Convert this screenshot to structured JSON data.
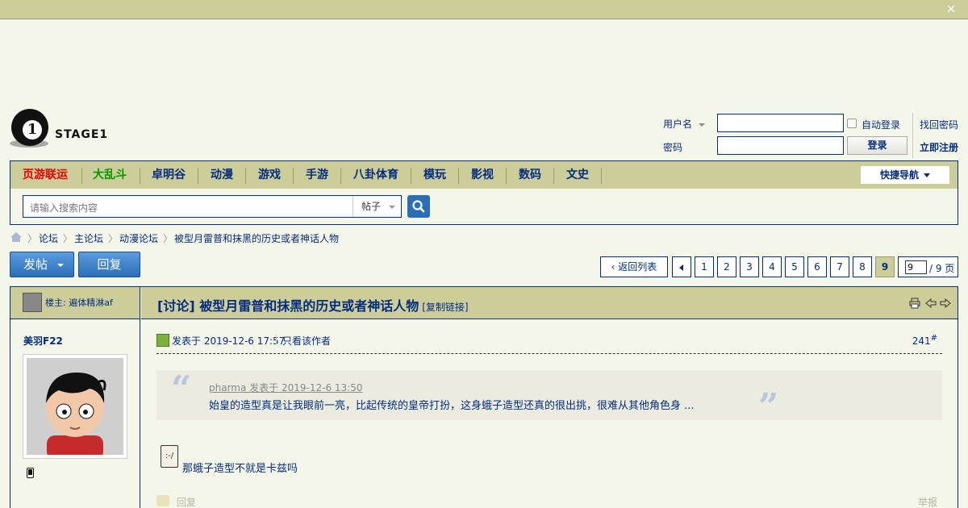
{
  "topbar": {
    "close_icon": "close-icon"
  },
  "logo": {
    "text": "STAGE1",
    "mark": "1"
  },
  "login": {
    "username_label": "用户名",
    "password_label": "密码",
    "auto_login_label": "自动登录",
    "login_button": "登录",
    "find_password": "找回密码",
    "register": "立即注册"
  },
  "nav": {
    "items": [
      {
        "label": "页游联运",
        "color": "#e60000"
      },
      {
        "label": "大乱斗",
        "color": "#009900"
      },
      {
        "label": "卓明谷",
        "color": "#022c80"
      },
      {
        "label": "动漫",
        "color": "#022c80"
      },
      {
        "label": "游戏",
        "color": "#022c80"
      },
      {
        "label": "手游",
        "color": "#022c80"
      },
      {
        "label": "八卦体育",
        "color": "#022c80"
      },
      {
        "label": "模玩",
        "color": "#022c80"
      },
      {
        "label": "影视",
        "color": "#022c80"
      },
      {
        "label": "数码",
        "color": "#022c80"
      },
      {
        "label": "文史",
        "color": "#022c80"
      }
    ],
    "quick_nav": "快捷导航"
  },
  "search": {
    "placeholder": "请输入搜索内容",
    "type": "帖子"
  },
  "breadcrumb": [
    "论坛",
    "主论坛",
    "动漫论坛",
    "被型月雷普和抹黑的历史或者神话人物"
  ],
  "actions": {
    "post": "发帖",
    "reply": "回复"
  },
  "pagination": {
    "back": "返回列表",
    "pages": [
      "1",
      "2",
      "3",
      "4",
      "5",
      "6",
      "7",
      "8",
      "9"
    ],
    "current": "9",
    "input_value": "9",
    "total": "/ 9 页"
  },
  "post": {
    "owner_label": "楼主: 遍体精淋af",
    "author": "美羽F22",
    "title": "[讨论] 被型月雷普和抹黑的历史或者神话人物",
    "copy_link": "[复制链接]",
    "posted_at": "发表于 2019-12-6 17:57",
    "only_author": "只看该作者",
    "floor": "241",
    "floor_mark": "#",
    "quote_header": "pharma 发表于 2019-12-6 13:50",
    "quote_body": "始皇的造型真是让我眼前一亮，比起传统的皇帝打扮，这身蛾子造型还真的很出挑，很难从其他角色身 ...",
    "body": "那蛾子造型不就是卡兹吗",
    "reply": "回复",
    "report": "举报"
  },
  "colors": {
    "accent": "#022c80",
    "bar": "#cdcd99",
    "page_bg": "#f5f6ea",
    "button": "#2a6fb5"
  }
}
